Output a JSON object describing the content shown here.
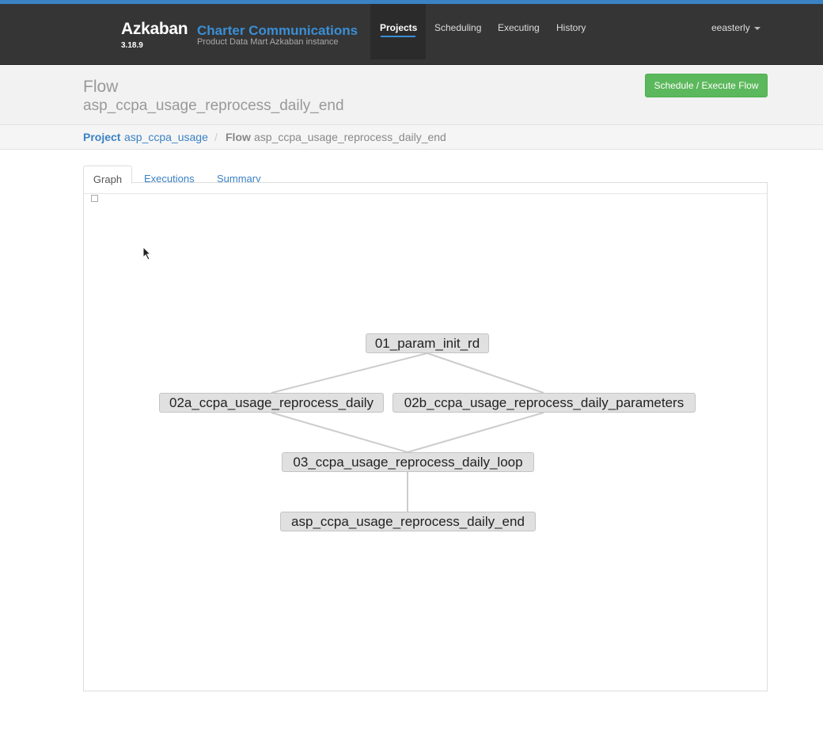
{
  "app": {
    "brand": "Azkaban",
    "version": "3.18.9",
    "company": "Charter Communications",
    "subtitle": "Product Data Mart Azkaban instance"
  },
  "nav": {
    "items": [
      {
        "label": "Projects",
        "active": true
      },
      {
        "label": "Scheduling",
        "active": false
      },
      {
        "label": "Executing",
        "active": false
      },
      {
        "label": "History",
        "active": false
      }
    ],
    "user": "eeasterly"
  },
  "header": {
    "title": "Flow",
    "flow_name": "asp_ccpa_usage_reprocess_daily_end",
    "action_button": "Schedule / Execute Flow"
  },
  "breadcrumb": {
    "project_label": "Project",
    "project_name": "asp_ccpa_usage",
    "separator": "/",
    "flow_label": "Flow",
    "flow_name": "asp_ccpa_usage_reprocess_daily_end"
  },
  "tabs": [
    {
      "label": "Graph",
      "active": true
    },
    {
      "label": "Executions",
      "active": false
    },
    {
      "label": "Summary",
      "active": false
    }
  ],
  "graph": {
    "nodes": [
      {
        "id": "n1",
        "label": "01_param_init_rd"
      },
      {
        "id": "n2a",
        "label": "02a_ccpa_usage_reprocess_daily"
      },
      {
        "id": "n2b",
        "label": "02b_ccpa_usage_reprocess_daily_parameters"
      },
      {
        "id": "n3",
        "label": "03_ccpa_usage_reprocess_daily_loop"
      },
      {
        "id": "n4",
        "label": "asp_ccpa_usage_reprocess_daily_end"
      }
    ],
    "edges": [
      [
        "n1",
        "n2a"
      ],
      [
        "n1",
        "n2b"
      ],
      [
        "n2a",
        "n3"
      ],
      [
        "n2b",
        "n3"
      ],
      [
        "n3",
        "n4"
      ]
    ],
    "colors": {
      "node_fill": "#e0e0e0",
      "edge": "#cccccc"
    }
  },
  "colors": {
    "accent": "#3a82c4",
    "navbar": "#353535",
    "success": "#5cb85c"
  }
}
